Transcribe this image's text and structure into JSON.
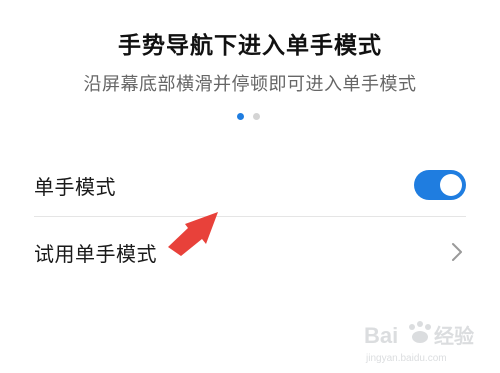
{
  "header": {
    "title": "手势导航下进入单手模式",
    "subtitle": "沿屏幕底部横滑并停顿即可进入单手模式"
  },
  "pager": {
    "count": 2,
    "active_index": 0
  },
  "settings": {
    "one_hand_mode": {
      "label": "单手模式",
      "enabled": true
    },
    "try_one_hand_mode": {
      "label": "试用单手模式"
    }
  },
  "colors": {
    "accent": "#1f7de0",
    "annotation_arrow": "#e8413a"
  },
  "icons": {
    "chevron": "chevron-right-icon",
    "annotation": "red-arrow-icon"
  },
  "watermark": {
    "brand": "Bai 经验",
    "url": "jingyan.baidu.com"
  }
}
